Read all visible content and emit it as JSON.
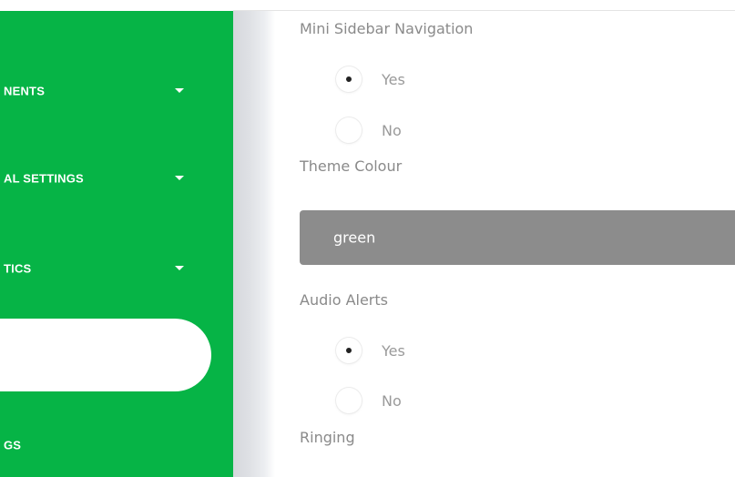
{
  "sidebar": {
    "background_color": "#06b446",
    "items": [
      {
        "label": "NENTS",
        "has_caret": true
      },
      {
        "label": "AL SETTINGS",
        "has_caret": true
      },
      {
        "label": "TICS",
        "has_caret": true
      },
      {
        "label": "",
        "active": true
      },
      {
        "label": "GS",
        "has_caret": false
      }
    ]
  },
  "settings": {
    "mini_sidebar": {
      "label": "Mini Sidebar Navigation",
      "options": [
        {
          "label": "Yes",
          "checked": true
        },
        {
          "label": "No",
          "checked": false
        }
      ]
    },
    "theme_colour": {
      "label": "Theme Colour",
      "selected": "green",
      "select_background": "#8c8c8c"
    },
    "audio_alerts": {
      "label": "Audio Alerts",
      "options": [
        {
          "label": "Yes",
          "checked": true
        },
        {
          "label": "No",
          "checked": false
        }
      ]
    },
    "ringing": {
      "label": "Ringing"
    }
  }
}
